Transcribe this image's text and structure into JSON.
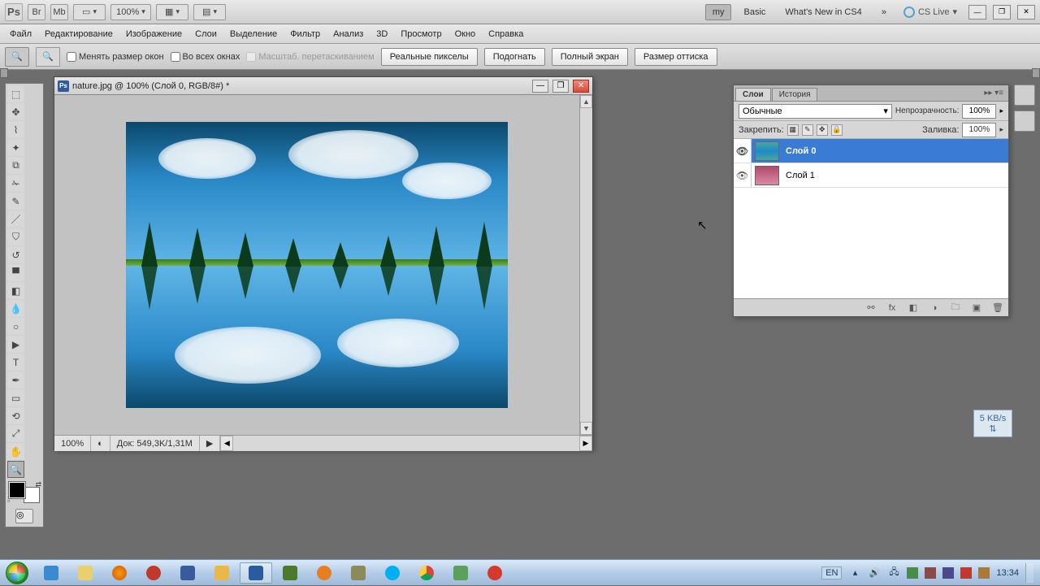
{
  "app_top": {
    "zoom_pct": "100%",
    "workspace": {
      "my": "my",
      "basic": "Basic",
      "whatsnew": "What's New in CS4"
    },
    "cslive": "CS Live"
  },
  "menu": [
    "Файл",
    "Редактирование",
    "Изображение",
    "Слои",
    "Выделение",
    "Фильтр",
    "Анализ",
    "3D",
    "Просмотр",
    "Окно",
    "Справка"
  ],
  "options": {
    "resize_windows": "Менять размер окон",
    "all_windows": "Во всех окнах",
    "scrubby": "Масштаб. перетаскиванием",
    "actual_pixels": "Реальные пикселы",
    "fit": "Подогнать",
    "fullscreen": "Полный экран",
    "print_size": "Размер оттиска"
  },
  "doc": {
    "title": "nature.jpg @ 100% (Слой 0, RGB/8#) *",
    "status_zoom": "100%",
    "status_doc": "Док: 549,3K/1,31M"
  },
  "layers_panel": {
    "tab_layers": "Слои",
    "tab_history": "История",
    "blend_mode": "Обычные",
    "opacity_label": "Непрозрачность:",
    "opacity_value": "100%",
    "lock_label": "Закрепить:",
    "fill_label": "Заливка:",
    "fill_value": "100%",
    "layers": [
      {
        "name": "Слой 0",
        "selected": true
      },
      {
        "name": "Слой 1",
        "selected": false
      }
    ]
  },
  "netwidget": {
    "line1": "5 KB/s"
  },
  "tray": {
    "lang": "EN",
    "time": "13:34"
  }
}
